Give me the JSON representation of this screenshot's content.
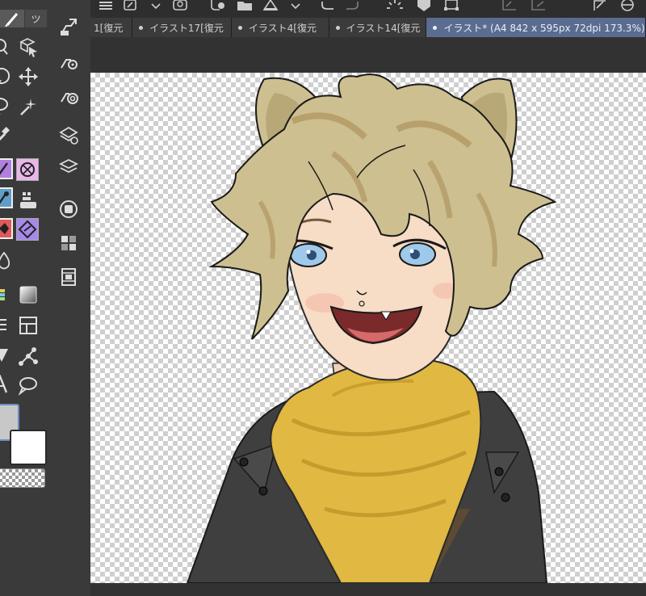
{
  "left_toolbar": {
    "tab_label": "ツ",
    "tools": [
      "brush-icon",
      "zoom-icon",
      "object-select-icon",
      "rotate-icon",
      "move-icon",
      "lasso-icon",
      "magic-wand-icon",
      "eyedropper-icon",
      "pen-tool-icon",
      "decoration-icon",
      "fill-tool-icon",
      "eraser-icon",
      "blend-icon",
      "liquify-icon",
      "gradient-icon",
      "ruler-icon",
      "frame-icon",
      "figure-icon",
      "operation-icon",
      "text-icon",
      "balloon-icon"
    ]
  },
  "color": {
    "main": "#c8c8c8",
    "sub": "#ffffff",
    "transparent_label": ""
  },
  "command_bar": {
    "icons": [
      "layer-property-icon",
      "layer-settings-icon",
      "layer-search-icon",
      "material-icon",
      "layers-icon",
      "navigator-icon",
      "subview-icon",
      "animation-timeline-icon"
    ]
  },
  "tabs": [
    {
      "label": "1[復元"
    },
    {
      "label": "イラスト17[復元"
    },
    {
      "label": "イラスト4[復元"
    },
    {
      "label": "イラスト14[復元"
    },
    {
      "label": "イラスト* (A4 842 x 595px 72dpi 173.3%)"
    }
  ],
  "active_tab_index": 4,
  "top_toolbar": {
    "icons": [
      "menu-icon",
      "new-icon",
      "chevron-down-icon",
      "save-icon",
      "add-tool-icon",
      "folder-icon",
      "fill-icon",
      "chevron-down-icon",
      "undo-icon",
      "redo-icon",
      "loading-icon",
      "heart-icon",
      "transform-icon",
      "grid-icon",
      "crop-icon",
      "shape-icon"
    ]
  },
  "canvas": {
    "background": "transparent-checkerboard",
    "artwork": "character-illustration"
  },
  "colors": {
    "panel_bg": "#3a3a3a",
    "active_tab": "#5a6c8f",
    "hair": "#cdbf8f",
    "skin": "#f7dcc6",
    "scarf": "#e0b842",
    "jacket": "#3f3f3f",
    "eyes": "#9ec9ea"
  }
}
